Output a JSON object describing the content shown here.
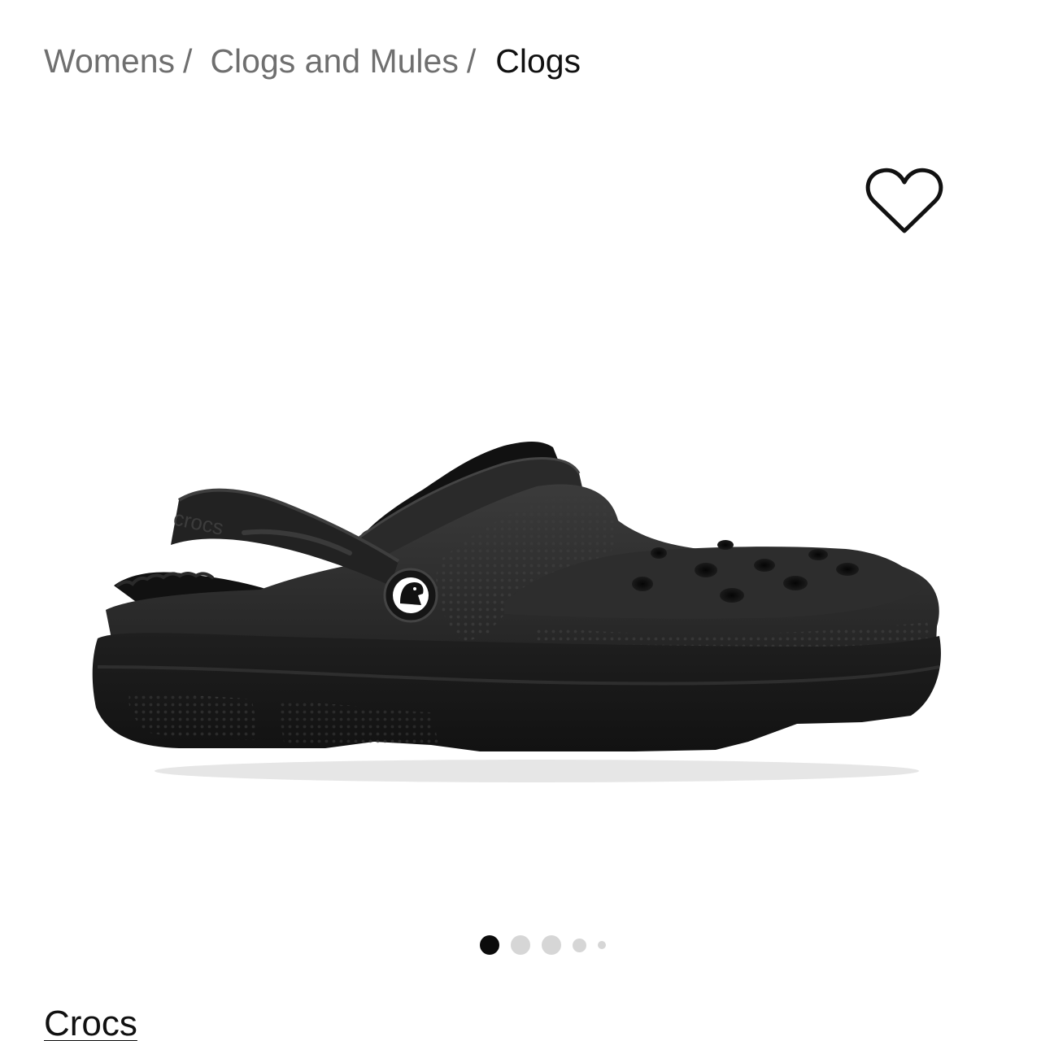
{
  "breadcrumb": {
    "items": [
      {
        "label": "Womens",
        "separator": "/"
      },
      {
        "label": "Clogs and Mules",
        "separator": "/"
      }
    ],
    "current": "Clogs"
  },
  "wishlist": {
    "icon": "heart-outline-icon"
  },
  "product": {
    "image_subject": "black lined clog shoe",
    "brand": "Crocs",
    "gallery": {
      "total_images": 5,
      "active_index": 0
    }
  },
  "colors": {
    "breadcrumb_text": "#6f6f6f",
    "text_dark": "#111111",
    "dot_active": "#0b0b0b",
    "dot_inactive": "#d6d6d6"
  }
}
